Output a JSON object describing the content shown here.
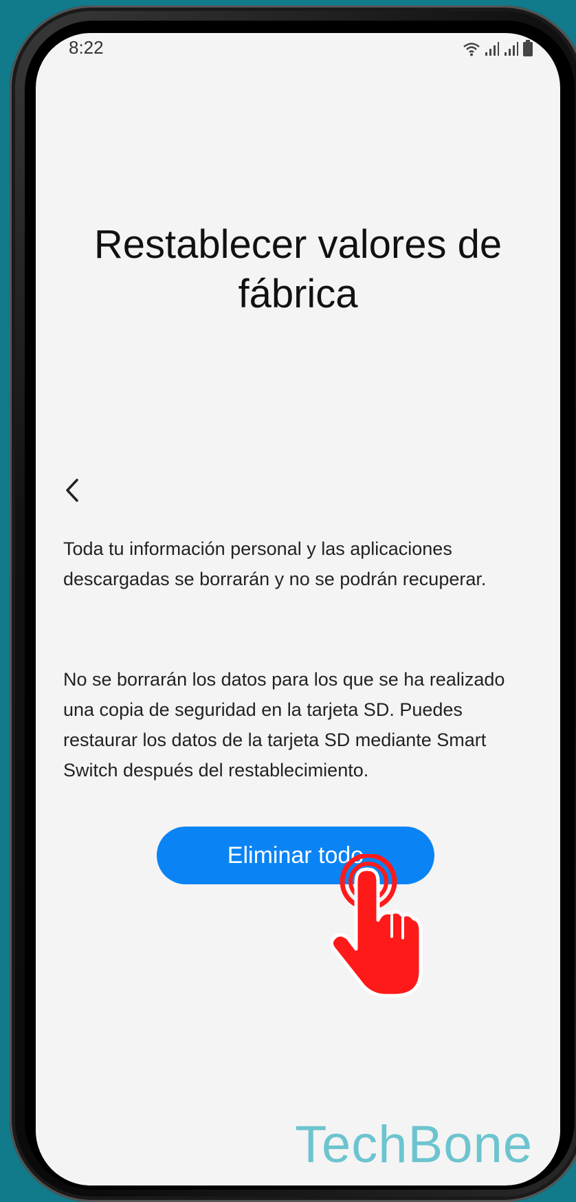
{
  "status_bar": {
    "time": "8:22",
    "icons": [
      "wifi-icon",
      "signal-icon",
      "signal-icon",
      "battery-icon"
    ]
  },
  "page": {
    "title": "Restablecer valores de fábrica",
    "back_icon": "chevron-left-icon",
    "paragraph_1": "Toda tu información personal y las aplicaciones descargadas se borrarán y no se podrán recuperar.",
    "paragraph_2": "No se borrarán los datos para los que se ha realizado una copia de seguridad en la tarjeta SD. Puedes restaurar los datos de la tarjeta SD mediante Smart Switch después del restablecimiento.",
    "primary_button": "Eliminar todo"
  },
  "overlay": {
    "pointer_icon": "tap-hand-icon",
    "watermark": "TechBone"
  },
  "colors": {
    "background": "#117a8b",
    "screen": "#f4f4f4",
    "accent": "#0a84f5",
    "pointer": "#ff1a1a",
    "watermark": "#6cc4cf"
  }
}
